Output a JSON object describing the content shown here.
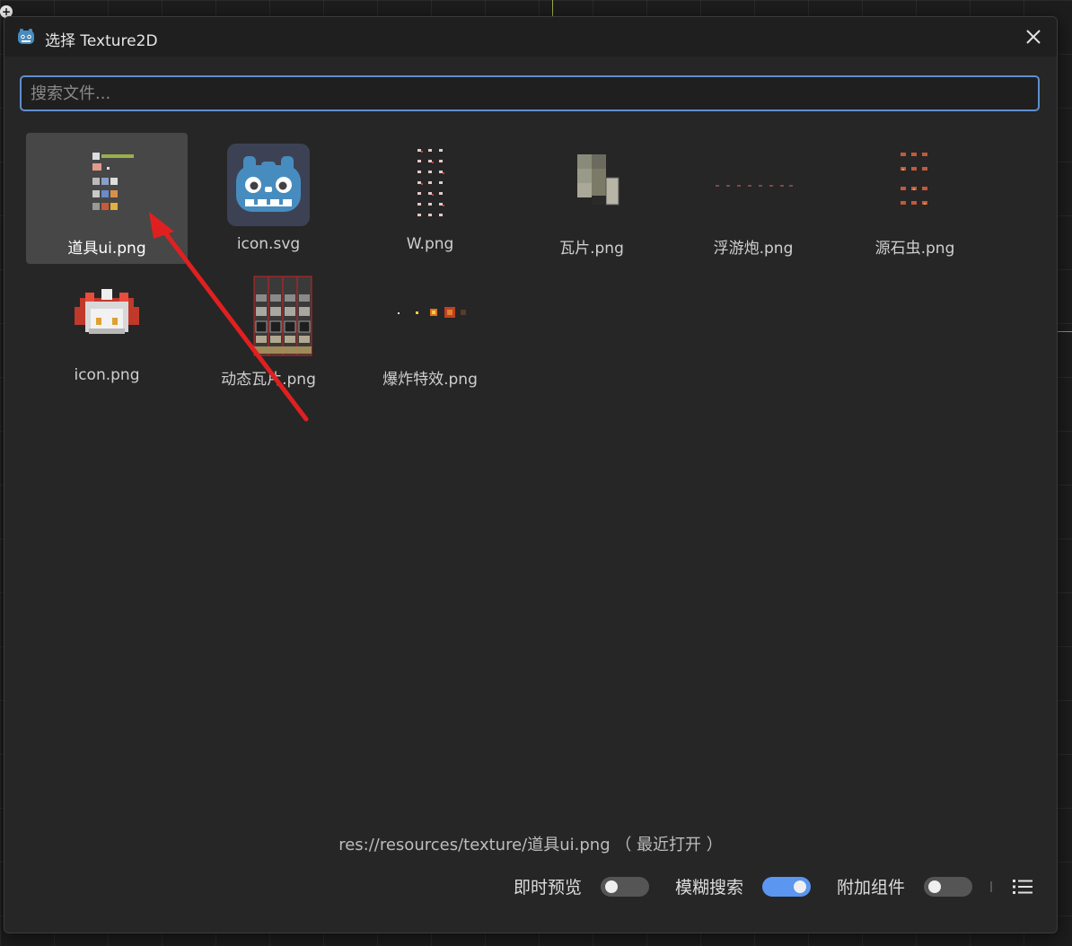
{
  "window": {
    "title": "选择 Texture2D",
    "app_icon": "godot-icon",
    "close_icon": "close-icon"
  },
  "search": {
    "placeholder": "搜索文件...",
    "value": ""
  },
  "files": [
    {
      "name": "道具ui.png",
      "selected": true,
      "icon": "item-sprite-sheet"
    },
    {
      "name": "icon.svg",
      "selected": false,
      "icon": "godot-icon"
    },
    {
      "name": "W.png",
      "selected": false,
      "icon": "sprite-grid"
    },
    {
      "name": "瓦片.png",
      "selected": false,
      "icon": "tile-sheet"
    },
    {
      "name": "浮游炮.png",
      "selected": false,
      "icon": "sprite-strip"
    },
    {
      "name": "源石虫.png",
      "selected": false,
      "icon": "sprite-grid"
    },
    {
      "name": "icon.png",
      "selected": false,
      "icon": "pixel-character"
    },
    {
      "name": "动态瓦片.png",
      "selected": false,
      "icon": "animated-tile-sheet"
    },
    {
      "name": "爆炸特效.png",
      "selected": false,
      "icon": "explosion-strip"
    }
  ],
  "status": {
    "path_text": "res://resources/texture/道具ui.png （ 最近打开 ）"
  },
  "options": {
    "instant_preview": {
      "label": "即时预览",
      "on": false
    },
    "fuzzy_search": {
      "label": "模糊搜索",
      "on": true
    },
    "extra_components": {
      "label": "附加组件",
      "on": false
    }
  },
  "view_mode_icon": "list-view-icon",
  "colors": {
    "accent": "#5b96f0",
    "selection_bg": "#474747",
    "dialog_bg": "#262626",
    "annotation_arrow": "#e02020"
  }
}
